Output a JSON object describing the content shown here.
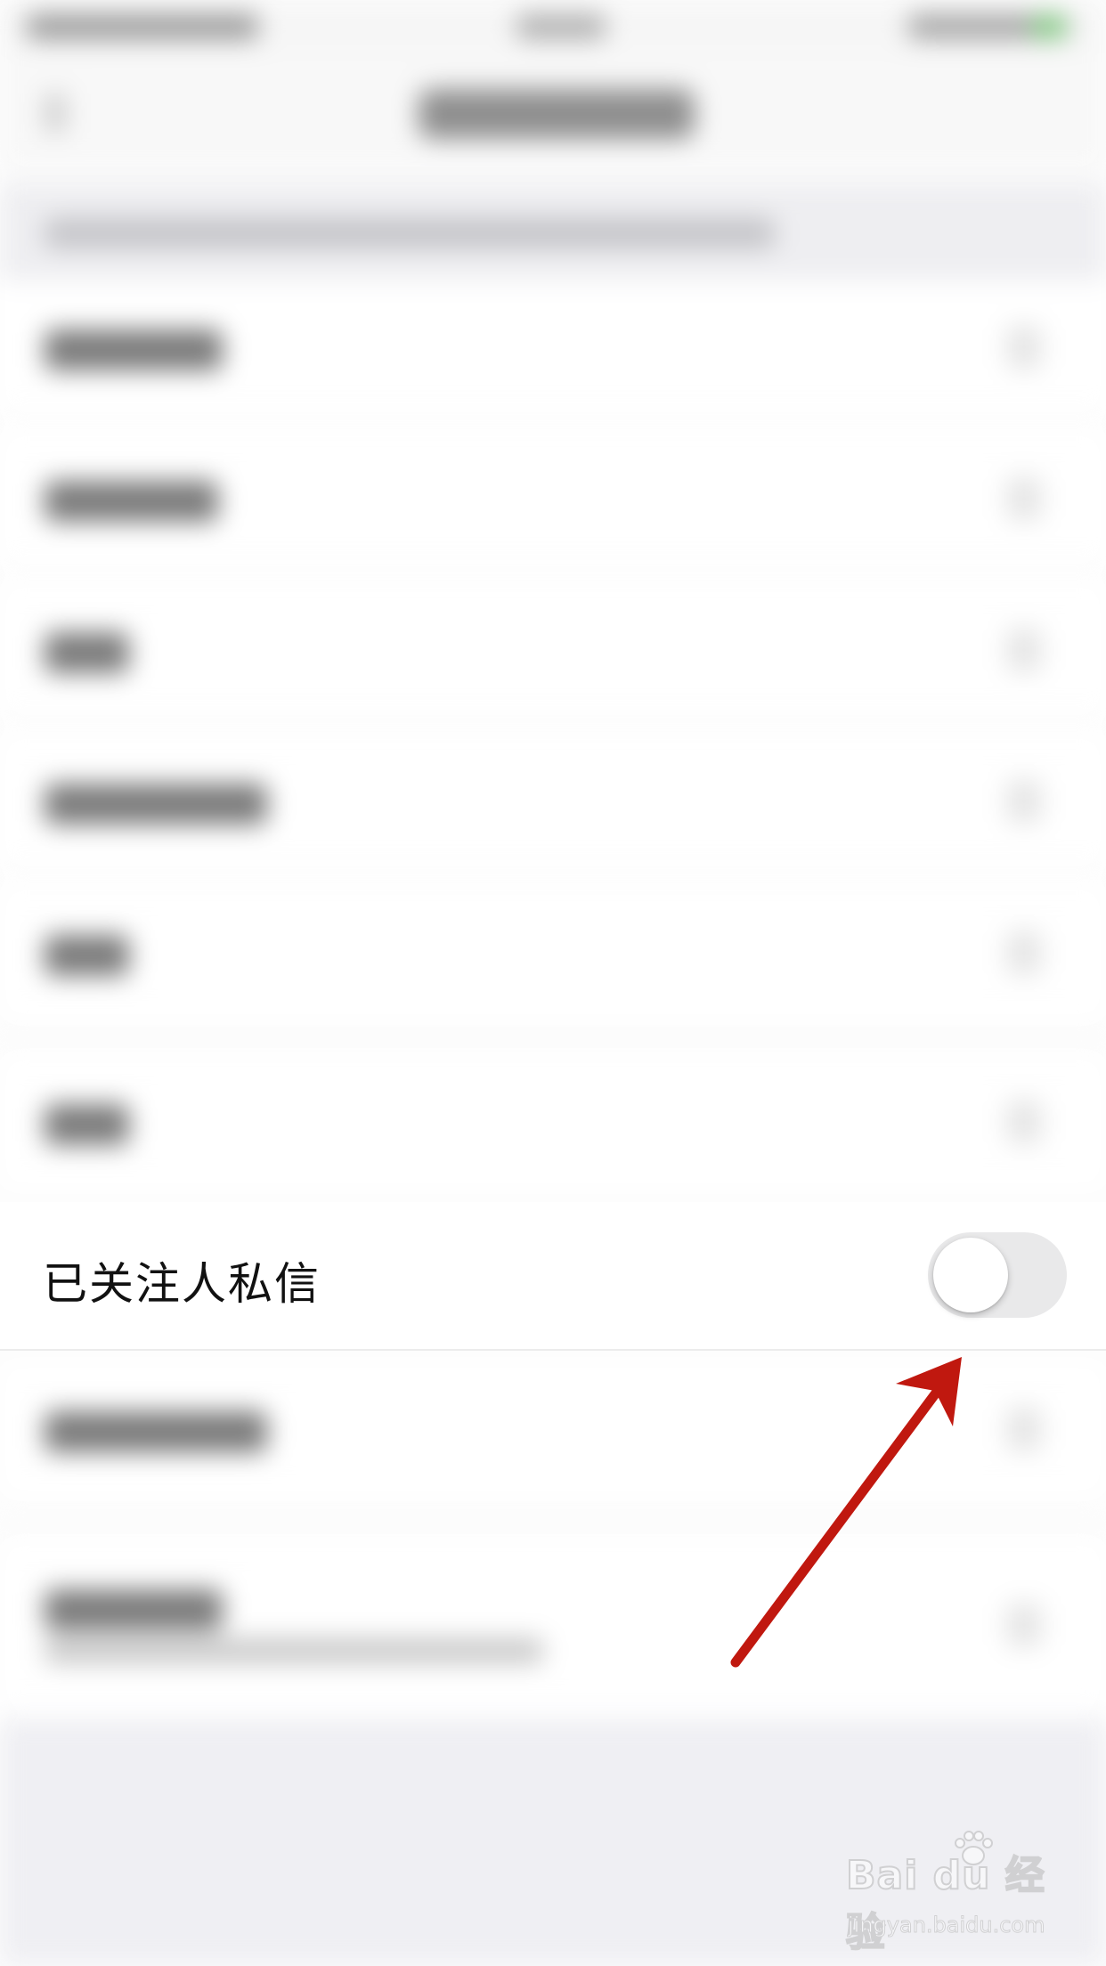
{
  "settings": {
    "highlighted_row": {
      "label": "已关注人私信",
      "toggle_on": false
    }
  },
  "annotation": {
    "arrow_color": "#c0180f",
    "arrow_target": "toggle-switch"
  },
  "watermark": {
    "logo_text": "Bai du 经验",
    "site_text": "jingyan.baidu.com"
  },
  "colors": {
    "toggle_off_track": "#e9e9ea",
    "toggle_knob": "#ffffff",
    "background": "#fdfdfd",
    "bottom_area": "#efeff3"
  }
}
